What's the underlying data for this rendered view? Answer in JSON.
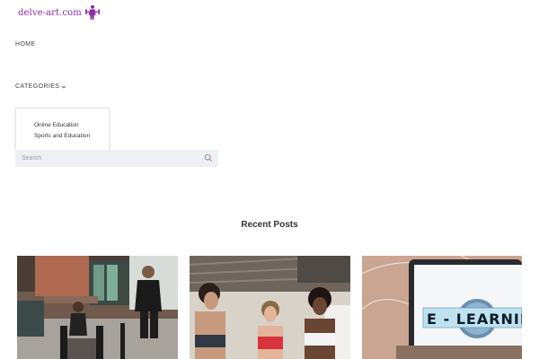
{
  "logo": {
    "text": "delve-art.com",
    "icon": "fitness-person-icon"
  },
  "nav": {
    "home": "HOME",
    "categories": "CATEGORIES",
    "dropdown": [
      "Online Education",
      "Sports and Education"
    ]
  },
  "search": {
    "placeholder": "Search",
    "icon": "search-icon"
  },
  "recent": {
    "title": "Recent Posts",
    "posts": [
      {
        "image": "gym-trainer-photo"
      },
      {
        "image": "women-fitness-photo"
      },
      {
        "image": "e-learning-laptop-photo"
      }
    ]
  },
  "card3_text": "E - LEARNING",
  "colors": {
    "brand": "#8e2aa8",
    "search_bg": "#eef0f3",
    "text": "#333333"
  }
}
